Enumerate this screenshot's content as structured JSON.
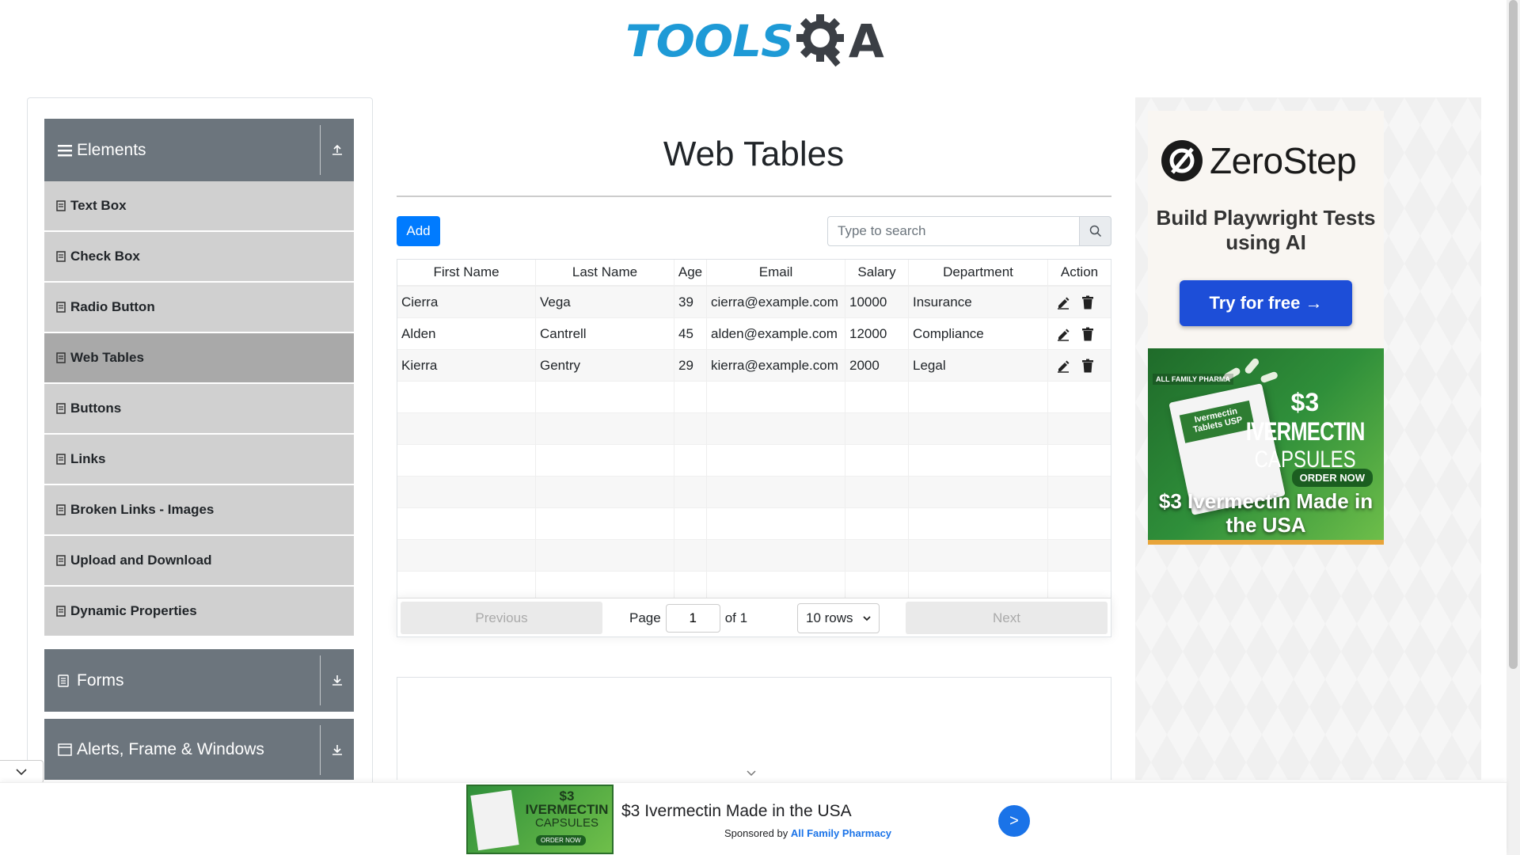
{
  "logo": {
    "text": "TOOLS",
    "letter": "A"
  },
  "sidebar": {
    "groups": [
      {
        "label": "Elements",
        "toggle": "collapse"
      },
      {
        "label": "Forms",
        "toggle": "expand"
      },
      {
        "label": "Alerts, Frame & Windows",
        "toggle": "expand"
      }
    ],
    "items": [
      {
        "label": "Text Box"
      },
      {
        "label": "Check Box"
      },
      {
        "label": "Radio Button"
      },
      {
        "label": "Web Tables",
        "active": true
      },
      {
        "label": "Buttons"
      },
      {
        "label": "Links"
      },
      {
        "label": "Broken Links - Images"
      },
      {
        "label": "Upload and Download"
      },
      {
        "label": "Dynamic Properties"
      }
    ]
  },
  "main": {
    "title": "Web Tables",
    "add_label": "Add",
    "search_placeholder": "Type to search"
  },
  "table": {
    "headers": [
      "First Name",
      "Last Name",
      "Age",
      "Email",
      "Salary",
      "Department",
      "Action"
    ],
    "rows": [
      [
        "Cierra",
        "Vega",
        "39",
        "cierra@example.com",
        "10000",
        "Insurance"
      ],
      [
        "Alden",
        "Cantrell",
        "45",
        "alden@example.com",
        "12000",
        "Compliance"
      ],
      [
        "Kierra",
        "Gentry",
        "29",
        "kierra@example.com",
        "2000",
        "Legal"
      ]
    ],
    "empty_rows": 7
  },
  "pagination": {
    "previous": "Previous",
    "page_label": "Page",
    "page_value": "1",
    "of_label": "of 1",
    "rows_option": "10 rows",
    "next": "Next"
  },
  "ads": {
    "zerostep": {
      "name": "ZeroStep",
      "tagline": "Build Playwright Tests using AI",
      "cta": "Try for free →"
    },
    "ivermectin": {
      "brand": "ALL FAMILY PHARMA",
      "box_label": "Ivermectin Tablets USP",
      "price": "$3",
      "product": "IVERMECTIN",
      "form": "CAPSULES",
      "order": "ORDER NOW",
      "headline": "$3 Ivermectin Made in the USA"
    },
    "banner": {
      "title": "$3 Ivermectin Made in the USA",
      "sponsored_by": "Sponsored by",
      "sponsor": "All Family Pharmacy",
      "go": ">",
      "img_price": "$3",
      "img_product": "IVERMECTIN",
      "img_form": "CAPSULES",
      "img_order": "ORDER NOW"
    }
  },
  "colors": {
    "accent": "#007bff",
    "sidebar_header": "#6c757d",
    "menu_item": "#d0d0d0",
    "menu_active": "#a9a9a9"
  }
}
